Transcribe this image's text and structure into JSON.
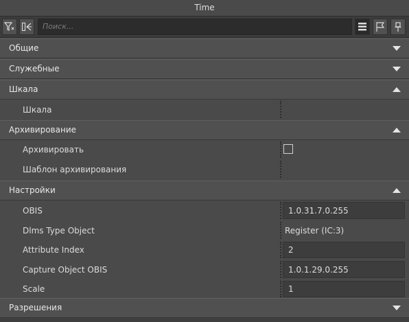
{
  "window": {
    "title": "Time"
  },
  "toolbar": {
    "search_placeholder": "Поиск...",
    "buttons": [
      "filter-icon",
      "collapse-icon",
      "list-icon",
      "flag-icon",
      "pin-icon"
    ]
  },
  "sections": {
    "obshie": {
      "label": "Общие",
      "expanded": false
    },
    "sluzhebnye": {
      "label": "Служебные",
      "expanded": false
    },
    "shkala": {
      "label": "Шкала",
      "expanded": true,
      "rows": [
        {
          "label": "Шкала",
          "value": ""
        }
      ]
    },
    "archive": {
      "label": "Архивирование",
      "expanded": true,
      "rows": [
        {
          "label": "Архивировать",
          "value": "",
          "checked": false
        },
        {
          "label": "Шаблон архивирования",
          "value": ""
        }
      ]
    },
    "settings": {
      "label": "Настройки",
      "expanded": true,
      "rows": [
        {
          "label": "OBIS",
          "value": "1.0.31.7.0.255"
        },
        {
          "label": "Dlms Type Object",
          "value": "Register (IC:3)"
        },
        {
          "label": "Attribute Index",
          "value": "2"
        },
        {
          "label": "Capture Object OBIS",
          "value": "1.0.1.29.0.255"
        },
        {
          "label": "Scale",
          "value": "1"
        }
      ]
    },
    "permissions": {
      "label": "Разрешения",
      "expanded": false
    }
  }
}
